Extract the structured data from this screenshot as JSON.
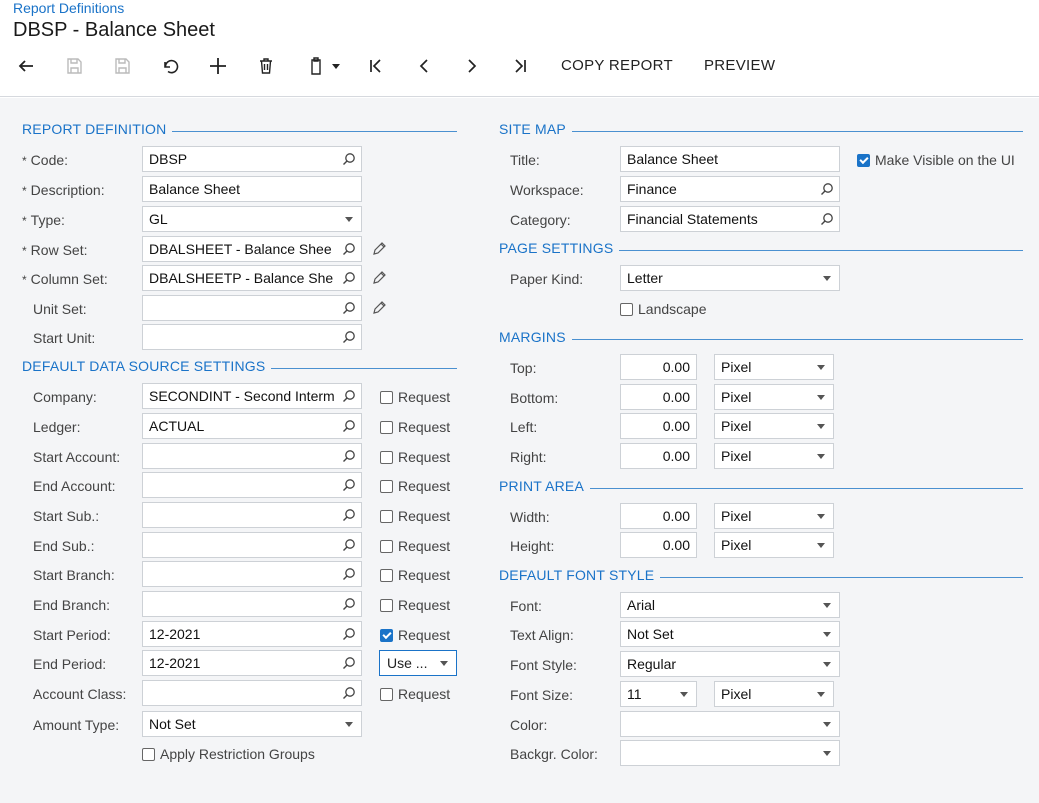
{
  "header": {
    "breadcrumb": "Report Definitions",
    "title": "DBSP - Balance Sheet"
  },
  "toolbar": {
    "copy_report": "COPY REPORT",
    "preview": "PREVIEW",
    "icons": [
      "back-arrow-icon",
      "save-close-icon",
      "save-icon",
      "undo-icon",
      "add-icon",
      "delete-icon",
      "clipboard-icon",
      "first-record-icon",
      "previous-record-icon",
      "next-record-icon",
      "last-record-icon"
    ]
  },
  "report_definition": {
    "section_title": "REPORT DEFINITION",
    "code_label": "Code:",
    "code_value": "DBSP",
    "description_label": "Description:",
    "description_value": "Balance Sheet",
    "type_label": "Type:",
    "type_value": "GL",
    "row_set_label": "Row Set:",
    "row_set_value": "DBALSHEET - Balance Shee",
    "column_set_label": "Column Set:",
    "column_set_value": "DBALSHEETP - Balance She",
    "unit_set_label": "Unit Set:",
    "unit_set_value": "",
    "start_unit_label": "Start Unit:",
    "start_unit_value": ""
  },
  "data_source": {
    "section_title": "DEFAULT DATA SOURCE SETTINGS",
    "request_label": "Request",
    "rows": [
      {
        "label": "Company:",
        "value": "SECONDINT - Second Interm",
        "request": false
      },
      {
        "label": "Ledger:",
        "value": "ACTUAL",
        "request": false
      },
      {
        "label": "Start Account:",
        "value": "",
        "request": false
      },
      {
        "label": "End Account:",
        "value": "",
        "request": false
      },
      {
        "label": "Start Sub.:",
        "value": "",
        "request": false
      },
      {
        "label": "End Sub.:",
        "value": "",
        "request": false
      },
      {
        "label": "Start Branch:",
        "value": "",
        "request": false
      },
      {
        "label": "End Branch:",
        "value": "",
        "request": false
      },
      {
        "label": "Start Period:",
        "value": "12-2021",
        "request": true
      },
      {
        "label": "End Period:",
        "value": "12-2021",
        "request": false
      },
      {
        "label": "Account Class:",
        "value": "",
        "request": false
      }
    ],
    "end_period_option": "Use ...",
    "amount_type_label": "Amount Type:",
    "amount_type_value": "Not Set",
    "apply_restriction_label": "Apply Restriction Groups"
  },
  "site_map": {
    "section_title": "SITE MAP",
    "title_label": "Title:",
    "title_value": "Balance Sheet",
    "make_visible_label": "Make Visible on the UI",
    "workspace_label": "Workspace:",
    "workspace_value": "Finance",
    "category_label": "Category:",
    "category_value": "Financial Statements"
  },
  "page_settings": {
    "section_title": "PAGE SETTINGS",
    "paper_kind_label": "Paper Kind:",
    "paper_kind_value": "Letter",
    "landscape_label": "Landscape"
  },
  "margins": {
    "section_title": "MARGINS",
    "rows": [
      {
        "label": "Top:",
        "value": "0.00",
        "unit": "Pixel"
      },
      {
        "label": "Bottom:",
        "value": "0.00",
        "unit": "Pixel"
      },
      {
        "label": "Left:",
        "value": "0.00",
        "unit": "Pixel"
      },
      {
        "label": "Right:",
        "value": "0.00",
        "unit": "Pixel"
      }
    ]
  },
  "print_area": {
    "section_title": "PRINT AREA",
    "rows": [
      {
        "label": "Width:",
        "value": "0.00",
        "unit": "Pixel"
      },
      {
        "label": "Height:",
        "value": "0.00",
        "unit": "Pixel"
      }
    ]
  },
  "font_style": {
    "section_title": "DEFAULT FONT STYLE",
    "font_label": "Font:",
    "font_value": "Arial",
    "text_align_label": "Text Align:",
    "text_align_value": "Not Set",
    "font_style_label": "Font Style:",
    "font_style_value": "Regular",
    "font_size_label": "Font Size:",
    "font_size_value": "11",
    "font_size_unit": "Pixel",
    "color_label": "Color:",
    "color_value": "",
    "backgr_color_label": "Backgr. Color:",
    "backgr_color_value": ""
  },
  "colors": {
    "accent": "#1a73c8",
    "background": "#f4f5f7"
  }
}
